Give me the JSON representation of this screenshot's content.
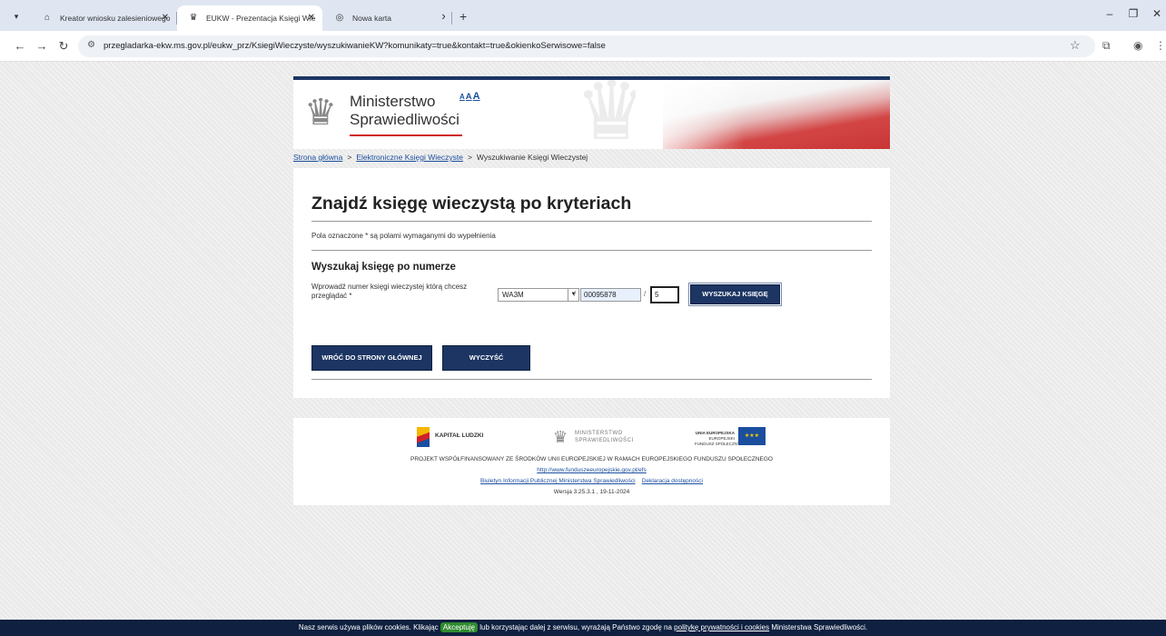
{
  "browser": {
    "tabs": [
      {
        "title": "Kreator wniosku zalesieniowego",
        "icon": "document-icon",
        "active": false
      },
      {
        "title": "EUKW - Prezentacja Księgi Wie",
        "icon": "eagle-icon",
        "active": true
      },
      {
        "title": "Nowa karta",
        "icon": "chrome-icon",
        "active": false
      }
    ],
    "new_tab_label": "+",
    "url": "przegladarka-ekw.ms.gov.pl/eukw_prz/KsiegiWieczyste/wyszukiwanieKW?komunikaty=true&kontakt=true&okienkoSerwisowe=false"
  },
  "header": {
    "brand_line1": "Ministerstwo",
    "brand_line2": "Sprawiedliwości",
    "font_sizes": [
      "A",
      "A",
      "A"
    ]
  },
  "breadcrumb": {
    "items": [
      "Strona główna",
      "Elektroniczne Księgi Wieczyste",
      "Wyszukiwanie Księgi Wieczystej"
    ],
    "separator": ">"
  },
  "form": {
    "title": "Znajdź księgę wieczystą po kryteriach",
    "required_note": "Pola oznaczone * są polami wymaganymi do wypełnienia",
    "section_title": "Wyszukaj księgę po numerze",
    "field_label": "Wprowadź numer księgi wieczystej którą chcesz przeglądać *",
    "court_code": "WA3M",
    "number": "00095878",
    "check_digit": "5",
    "slash": "/",
    "search_button": "WYSZUKAJ KSIĘGĘ",
    "back_button": "WRÓĆ DO STRONY GŁÓWNEJ",
    "clear_button": "WYCZYŚĆ"
  },
  "footer": {
    "logo_kl": "KAPITAŁ LUDZKI",
    "logo_ms_line1": "MINISTERSTWO",
    "logo_ms_line2": "SPRAWIEDLIWOŚCI",
    "logo_ue_line1": "UNIA EUROPEJSKA",
    "logo_ue_line2": "EUROPEJSKI",
    "logo_ue_line3": "FUNDUSZ SPOŁECZNY",
    "project_text": "PROJEKT WSPÓŁFINANSOWANY ZE ŚRODKÓW UNII EUROPEJSKIEJ W RAMACH EUROPEJSKIEGO FUNDUSZU SPOŁECZNEGO",
    "efs_link": "http://www.funduszeeuropejskie.gov.pl/efs",
    "bip_link": "Biuletyn Informacji Publicznej Ministerstwa Sprawiedliwości",
    "access_link": "Deklaracja dostępności",
    "version": "Wersja 3.25.3.1 , 19-11-2024"
  },
  "cookie": {
    "text_before": "Nasz serwis używa plików cookies. Klikając",
    "accept": "Akceptuję",
    "text_middle": "lub korzystając dalej z serwisu, wyrażają Państwo zgodę na",
    "policy_link": "politykę prywatności i cookies",
    "text_after": "Ministerstwa Sprawiedliwości."
  }
}
